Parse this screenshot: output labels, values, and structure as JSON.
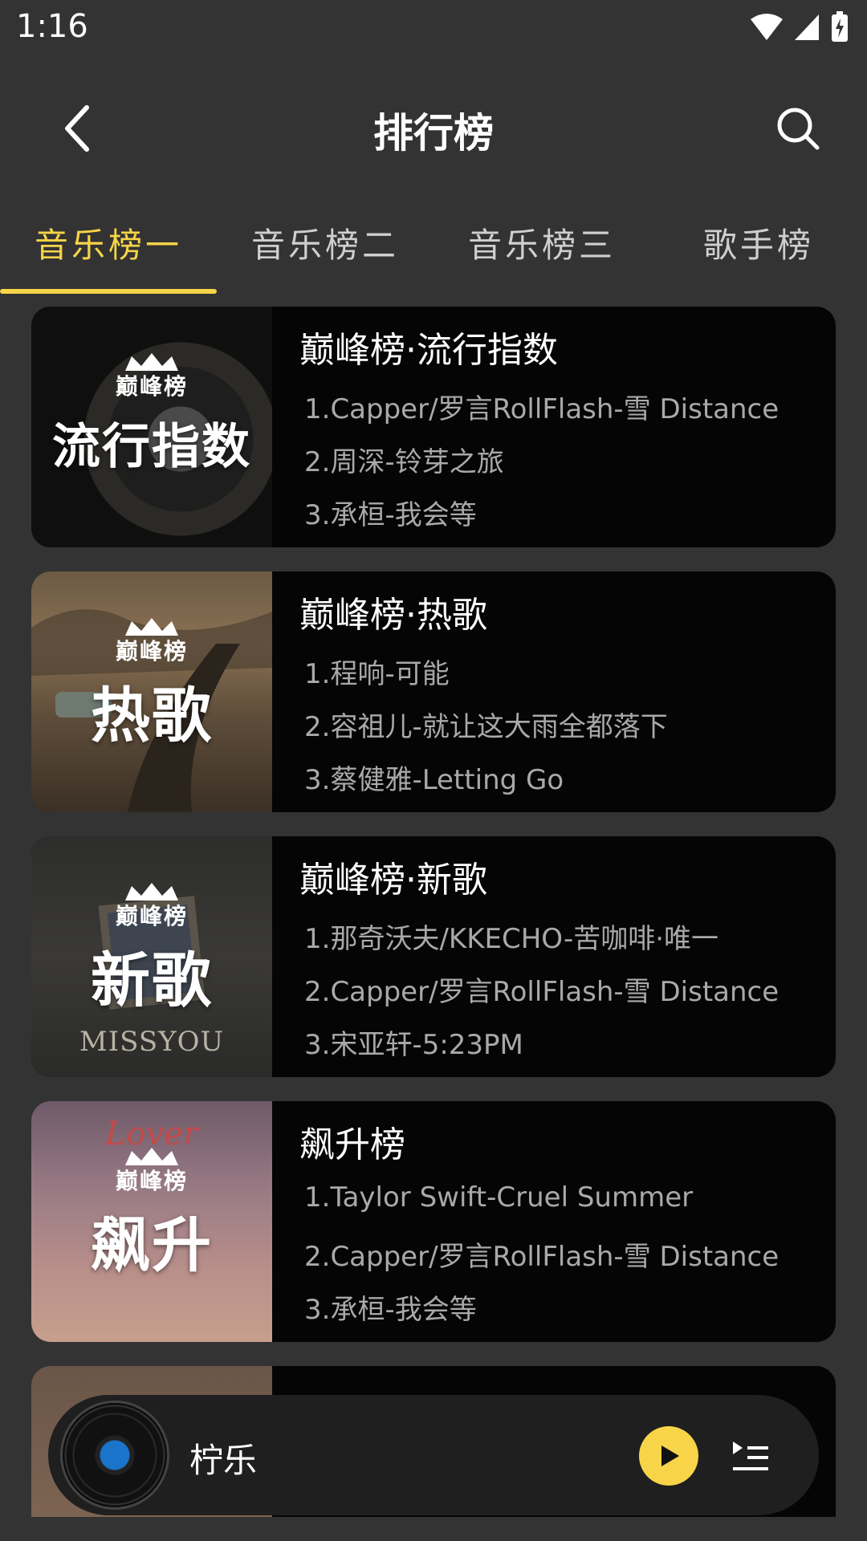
{
  "status_bar": {
    "time": "1:16"
  },
  "header": {
    "title": "排行榜"
  },
  "tabs": [
    {
      "label": "音乐榜一",
      "active": true
    },
    {
      "label": "音乐榜二",
      "active": false
    },
    {
      "label": "音乐榜三",
      "active": false
    },
    {
      "label": "歌手榜",
      "active": false
    }
  ],
  "charts": [
    {
      "cover_brand": "巅峰榜",
      "cover_title": "流行指数",
      "title": "巅峰榜·流行指数",
      "songs": [
        "1.Capper/罗言RollFlash-雪 Distance",
        "2.周深-铃芽之旅",
        "3.承桓-我会等"
      ]
    },
    {
      "cover_brand": "巅峰榜",
      "cover_title": "热歌",
      "title": "巅峰榜·热歌",
      "songs": [
        "1.程响-可能",
        "2.容祖儿-就让这大雨全都落下",
        "3.蔡健雅-Letting Go"
      ]
    },
    {
      "cover_brand": "巅峰榜",
      "cover_title": "新歌",
      "cover_caption": "MISSYOU",
      "title": "巅峰榜·新歌",
      "songs": [
        "1.那奇沃夫/KKECHO-苦咖啡·唯一",
        "2.Capper/罗言RollFlash-雪 Distance",
        "3.宋亚轩-5:23PM"
      ]
    },
    {
      "cover_brand": "巅峰榜",
      "cover_title": "飙升",
      "cover_caption": "Lover",
      "title": "飙升榜",
      "songs": [
        "1.Taylor Swift-Cruel Summer",
        "2.Capper/罗言RollFlash-雪 Distance",
        "3.承桓-我会等"
      ]
    }
  ],
  "player": {
    "track_name": "柠乐"
  },
  "colors": {
    "accent": "#f7d448",
    "background": "#333333",
    "card": "#050505"
  }
}
